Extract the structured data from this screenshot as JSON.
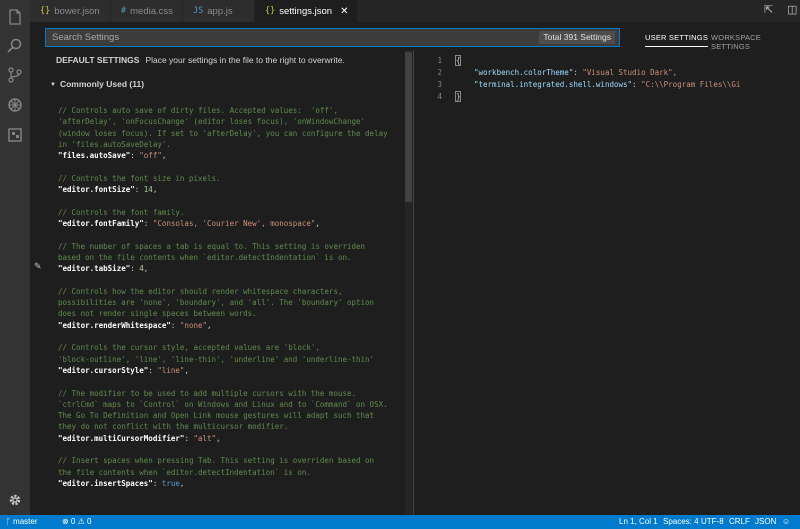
{
  "activity_bar": {
    "icons": [
      "files-icon",
      "search-icon",
      "source-control-icon",
      "debug-icon",
      "extensions-icon"
    ],
    "bottom_icon": "gear-icon"
  },
  "tabs": [
    {
      "label": "bower.json",
      "icon_glyph": "{}",
      "icon_color": "#cbcb41",
      "active": false
    },
    {
      "label": "media.css",
      "icon_glyph": "#",
      "icon_color": "#519aba",
      "active": false
    },
    {
      "label": "app.js",
      "icon_glyph": "JS",
      "icon_color": "#519aba",
      "active": false
    },
    {
      "label": "settings.json",
      "icon_glyph": "{}",
      "icon_color": "#cbcb41",
      "active": true,
      "close": "✕"
    }
  ],
  "search": {
    "placeholder": "Search Settings",
    "total": "Total 391 Settings"
  },
  "settings_tabs": {
    "user": "USER SETTINGS",
    "workspace": "WORKSPACE SETTINGS"
  },
  "default_settings": {
    "title": "DEFAULT SETTINGS",
    "subtitle": "Place your settings in the file to the right to overwrite."
  },
  "section": {
    "title": "Commonly Used (11)"
  },
  "default_lines": [
    {
      "type": "comment",
      "text": "// Controls auto save of dirty files. Accepted values:  'off',"
    },
    {
      "type": "comment",
      "text": "'afterDelay', 'onFocusChange' (editor loses focus), 'onWindowChange'"
    },
    {
      "type": "comment",
      "text": "(window loses focus). If set to 'afterDelay', you can configure the delay"
    },
    {
      "type": "comment",
      "text": "in 'files.autoSaveDelay'."
    },
    {
      "type": "code",
      "key": "\"files.autoSave\"",
      "value": "\"off\"",
      "vtype": "str"
    },
    {
      "type": "blank"
    },
    {
      "type": "comment",
      "text": "// Controls the font size in pixels."
    },
    {
      "type": "code",
      "key": "\"editor.fontSize\"",
      "value": "14",
      "vtype": "num"
    },
    {
      "type": "blank"
    },
    {
      "type": "comment",
      "text": "// Controls the font family."
    },
    {
      "type": "code",
      "key": "\"editor.fontFamily\"",
      "value": "\"Consolas, 'Courier New', monospace\"",
      "vtype": "str"
    },
    {
      "type": "blank"
    },
    {
      "type": "comment",
      "text": "// The number of spaces a tab is equal to. This setting is overriden"
    },
    {
      "type": "comment",
      "text": "based on the file contents when `editor.detectIndentation` is on."
    },
    {
      "type": "code",
      "key": "\"editor.tabSize\"",
      "value": "4",
      "vtype": "num",
      "pencil": true
    },
    {
      "type": "blank"
    },
    {
      "type": "comment",
      "text": "// Controls how the editor should render whitespace characters,"
    },
    {
      "type": "comment",
      "text": "possibilities are 'none', 'boundary', and 'all'. The 'boundary' option"
    },
    {
      "type": "comment",
      "text": "does not render single spaces between words."
    },
    {
      "type": "code",
      "key": "\"editor.renderWhitespace\"",
      "value": "\"none\"",
      "vtype": "str"
    },
    {
      "type": "blank"
    },
    {
      "type": "comment",
      "text": "// Controls the cursor style, accepted values are 'block',"
    },
    {
      "type": "comment",
      "text": "'block-outline', 'line', 'line-thin', 'underline' and 'underline-thin'"
    },
    {
      "type": "code",
      "key": "\"editor.cursorStyle\"",
      "value": "\"line\"",
      "vtype": "str"
    },
    {
      "type": "blank"
    },
    {
      "type": "comment",
      "text": "// The modifier to be used to add multiple cursors with the mouse."
    },
    {
      "type": "comment",
      "text": "`ctrlCmd` maps to `Control` on Windows and Linux and to `Command` on OSX."
    },
    {
      "type": "comment",
      "text": "The Go To Definition and Open Link mouse gestures will adapt such that"
    },
    {
      "type": "comment",
      "text": "they do not conflict with the multicursor modifier."
    },
    {
      "type": "code",
      "key": "\"editor.multiCursorModifier\"",
      "value": "\"alt\"",
      "vtype": "str"
    },
    {
      "type": "blank"
    },
    {
      "type": "comment",
      "text": "// Insert spaces when pressing Tab. This setting is overriden based on"
    },
    {
      "type": "comment",
      "text": "the file contents when `editor.detectIndentation` is on."
    },
    {
      "type": "code",
      "key": "\"editor.insertSpaces\"",
      "value": "true",
      "vtype": "kw"
    }
  ],
  "user_lines": [
    {
      "num": "1",
      "text": "{"
    },
    {
      "num": "2",
      "key": "\"workbench.colorTheme\"",
      "value": "\"Visual Studio Dark\","
    },
    {
      "num": "3",
      "key": "\"terminal.integrated.shell.windows\"",
      "value": "\"C:\\\\Program Files\\\\Gi"
    },
    {
      "num": "4",
      "text": "}"
    }
  ],
  "status": {
    "branch": "master",
    "problems": "⊗ 0 ⚠ 0",
    "position": "Ln 1, Col 1",
    "spaces": "Spaces: 4",
    "encoding": "UTF-8",
    "eol": "CRLF",
    "language": "JSON"
  }
}
